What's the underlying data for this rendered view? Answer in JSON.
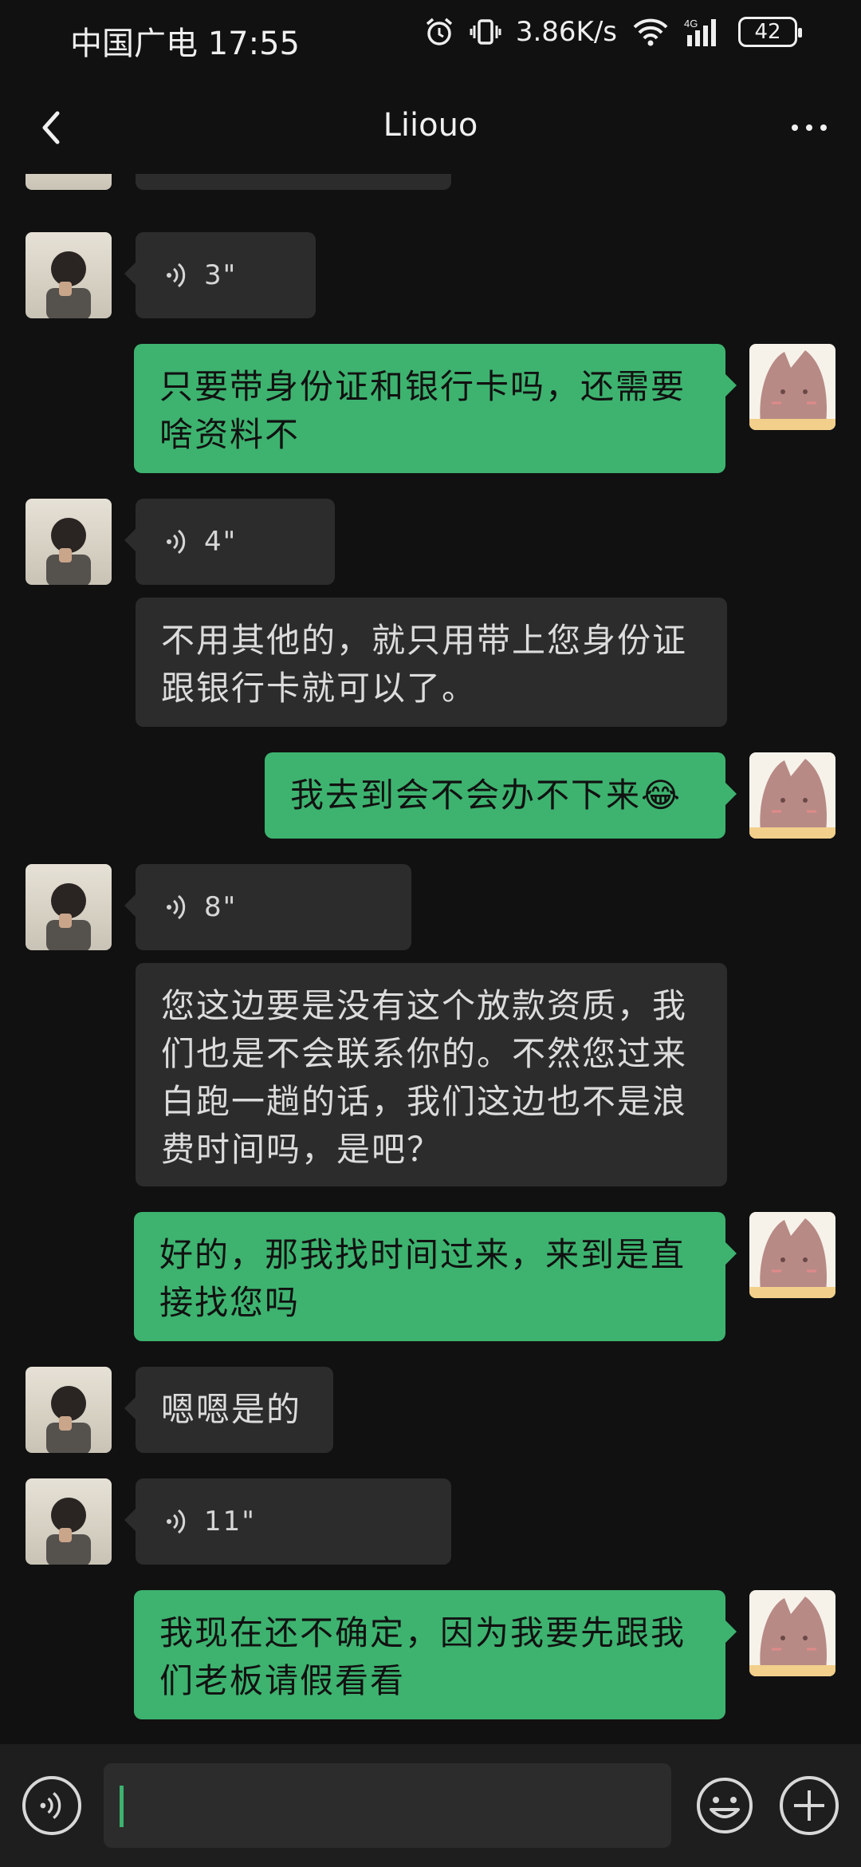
{
  "status_bar": {
    "carrier_time": "中国广电 17:55",
    "net_speed": "3.86K/s",
    "network": "4G",
    "battery": "42",
    "icons": [
      "alarm-icon",
      "vibrate-icon",
      "wifi-icon",
      "signal-icon",
      "battery-icon"
    ]
  },
  "header": {
    "title": "Liiouo",
    "back_icon": "back-chevron-icon",
    "more_icon": "more-dots-icon"
  },
  "messages": [
    {
      "side": "in",
      "type": "voice",
      "duration": "3\""
    },
    {
      "side": "out",
      "type": "text",
      "text": "只要带身份证和银行卡吗，还需要啥资料不"
    },
    {
      "side": "in",
      "type": "voice",
      "duration": "4\""
    },
    {
      "side": "in",
      "type": "text",
      "text": "不用其他的，就只用带上您身份证跟银行卡就可以了。"
    },
    {
      "side": "out",
      "type": "text",
      "text": "我去到会不会办不下来😂"
    },
    {
      "side": "in",
      "type": "voice",
      "duration": "8\""
    },
    {
      "side": "in",
      "type": "text",
      "text": "您这边要是没有这个放款资质，我们也是不会联系你的。不然您过来白跑一趟的话，我们这边也不是浪费时间吗，是吧？"
    },
    {
      "side": "out",
      "type": "text",
      "text": "好的，那我找时间过来，来到是直接找您吗"
    },
    {
      "side": "in",
      "type": "text",
      "text": "嗯嗯是的"
    },
    {
      "side": "in",
      "type": "voice",
      "duration": "11\""
    },
    {
      "side": "out",
      "type": "text",
      "text": "我现在还不确定，因为我要先跟我们老板请假看看"
    }
  ],
  "input_bar": {
    "value": "",
    "accent": "#3db36f",
    "icons": [
      "voice-input-icon",
      "emoji-icon",
      "plus-icon"
    ]
  },
  "colors": {
    "background": "#111111",
    "incoming_bubble": "#2c2c2c",
    "outgoing_bubble": "#3db36f"
  }
}
